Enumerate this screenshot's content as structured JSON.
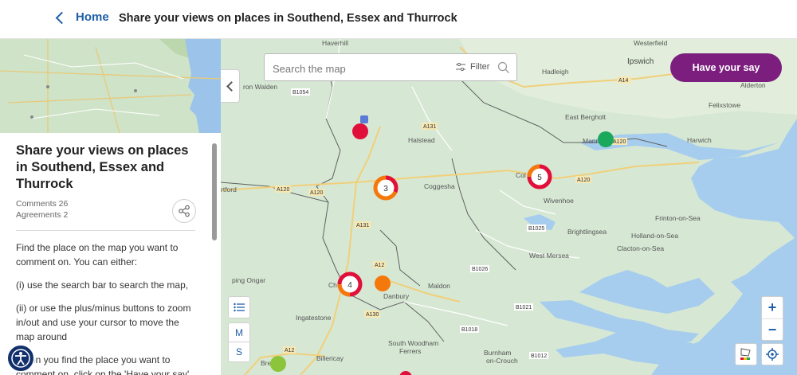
{
  "header": {
    "home_label": "Home",
    "page_title": "Share your views on places in Southend, Essex and Thurrock"
  },
  "sidebar": {
    "thumbnail_icon": "map-thumbnail",
    "title": "Share your views on places in Southend, Essex and Thurrock",
    "comments": "Comments 26",
    "agreements": "Agreements 2",
    "share_icon": "share-icon",
    "paragraphs": [
      "Find the place on the map you want to comment on. You can either:",
      "(i) use the search bar to search the map,",
      "(ii) or use the plus/minus buttons to zoom in/out and use your cursor to move the map around",
      "When you find the place you want to comment on, click on the 'Have your say'"
    ]
  },
  "map": {
    "search_placeholder": "Search the map",
    "filter_label": "Filter",
    "have_your_say": "Have your say",
    "zoom_in": "+",
    "zoom_out": "−",
    "layer_m": "M",
    "layer_s": "S",
    "clusters": [
      {
        "count": "3"
      },
      {
        "count": "5"
      },
      {
        "count": "4"
      }
    ],
    "place_labels": {
      "haverhill": "Haverhill",
      "westerfield": "Westerfield",
      "ipswich": "Ipswich",
      "hadleigh": "Hadleigh",
      "aldeton": "Alderton",
      "felixstowe": "Felixstowe",
      "east_bergholt": "East Bergholt",
      "harwich": "Harwich",
      "saffron_walden": "ron Walden",
      "halstead": "Halstead",
      "coggeshall": "Coggesha",
      "col": "Col",
      "wivenhoe": "Wivenhoe",
      "frinton": "Frinton-on-Sea",
      "holland": "Holland-on-Sea",
      "clacton": "Clacton-on-Sea",
      "brightlingsea": "Brightlingsea",
      "mersea": "West Mersea",
      "maldon": "Maldon",
      "chelmsford": "Ch      sford",
      "danbury": "Danbury",
      "ongar": "ping Ongar",
      "ingatestone": "Ingatestone",
      "south_woodham": "South Woodham",
      "ferrers": "Ferrers",
      "burnham": "Burnham",
      "on_crouch": "on-Crouch",
      "billericay": "Billericay",
      "brentwood": "Bre      od",
      "manningtree": "Mann      ea",
      "stortford": "rtford",
      "a14": "A14",
      "a131": "A131",
      "a120a": "A120",
      "a120b": "A120",
      "a120c": "A120",
      "a120d": "A120",
      "a131b": "A131",
      "a12": "A12",
      "a12b": "A12",
      "a130": "A130",
      "b1054": "B1054",
      "b1025": "B1025",
      "b1026": "B1026",
      "b1021": "B1021",
      "b1018": "B1018",
      "b1012": "B1012",
      "a14b": "A14"
    }
  },
  "colors": {
    "accent_purple": "#7b1e7e",
    "link_blue": "#1f5fa8",
    "pin_red": "#e0103a",
    "pin_green": "#1aa85c",
    "pin_orange": "#f5780a",
    "pin_lime": "#8cc43c"
  }
}
